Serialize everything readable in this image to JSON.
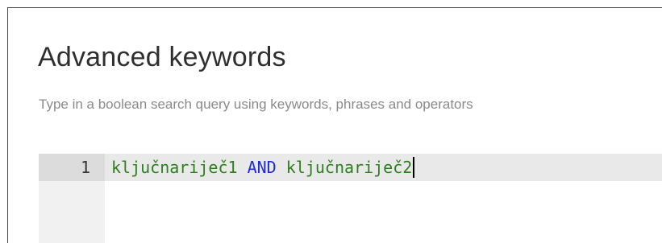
{
  "panel": {
    "title": "Advanced keywords",
    "description": "Type in a boolean search query using keywords, phrases and operators"
  },
  "editor": {
    "line_number": "1",
    "tokens": {
      "term1": "ključnariječ1",
      "space1": " ",
      "operator": "AND",
      "space2": " ",
      "term2": "ključnariječ2"
    },
    "colors": {
      "keyword": "#2e7d1f",
      "operator": "#1f2bd6",
      "gutter": "#f1f1f1",
      "active_line": "#e9e9e9"
    }
  }
}
